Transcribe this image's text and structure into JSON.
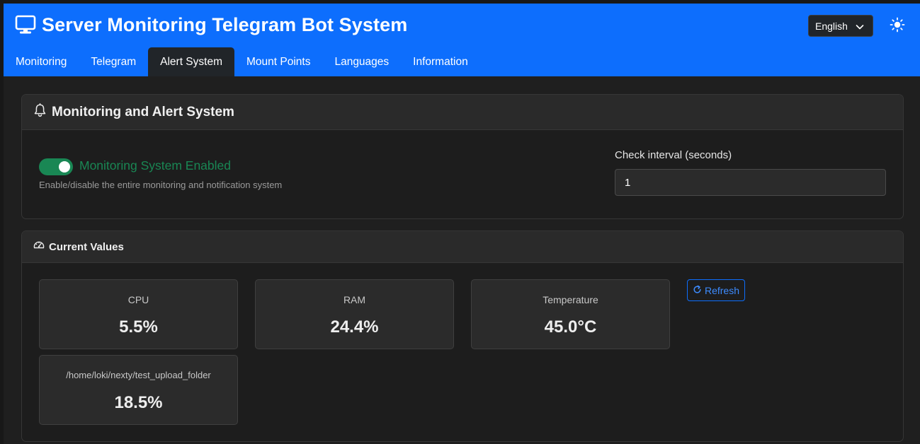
{
  "app": {
    "title": "Server Monitoring Telegram Bot System",
    "language": "English"
  },
  "tabs": [
    {
      "label": "Monitoring",
      "active": false
    },
    {
      "label": "Telegram",
      "active": false
    },
    {
      "label": "Alert System",
      "active": true
    },
    {
      "label": "Mount Points",
      "active": false
    },
    {
      "label": "Languages",
      "active": false
    },
    {
      "label": "Information",
      "active": false
    }
  ],
  "alert_card": {
    "title": "Monitoring and Alert System",
    "switch_label": "Monitoring System Enabled",
    "switch_on": true,
    "switch_help": "Enable/disable the entire monitoring and notification system",
    "interval_label": "Check interval (seconds)",
    "interval_value": "1"
  },
  "values_card": {
    "title": "Current Values",
    "refresh_label": "Refresh",
    "metrics": [
      {
        "label": "CPU",
        "value": "5.5%"
      },
      {
        "label": "RAM",
        "value": "24.4%"
      },
      {
        "label": "Temperature",
        "value": "45.0°C"
      },
      {
        "label": "/home/loki/nexty/test_upload_folder",
        "value": "18.5%"
      }
    ]
  },
  "colors": {
    "header": "#0d6efd",
    "success": "#198754",
    "background": "#1f1f1f"
  },
  "icons": {
    "title": "monitor-icon",
    "theme": "sun-icon",
    "alert_card": "bell-icon",
    "values_card": "speedometer-icon",
    "refresh": "refresh-icon"
  }
}
